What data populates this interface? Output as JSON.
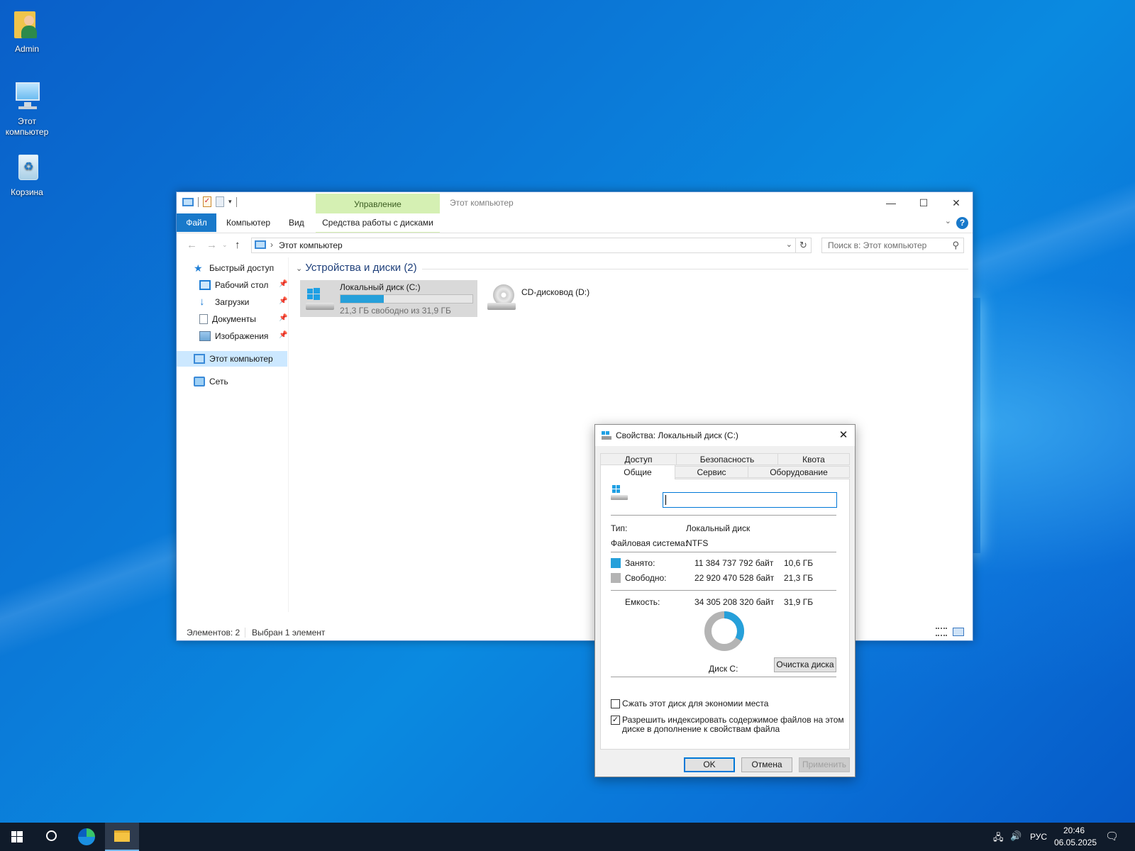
{
  "desktop": {
    "icons": [
      {
        "label": "Admin",
        "icon": "user-folder-icon"
      },
      {
        "label": "Этот компьютер",
        "icon": "computer-icon"
      },
      {
        "label": "Корзина",
        "icon": "recycle-bin-icon"
      }
    ]
  },
  "explorer": {
    "title": "Этот компьютер",
    "context_tab": "Управление",
    "ribbon_tabs": {
      "file": "Файл",
      "computer": "Компьютер",
      "view": "Вид",
      "drive_tools": "Средства работы с дисками"
    },
    "address": "Этот компьютер",
    "search_placeholder": "Поиск в: Этот компьютер",
    "sidebar": {
      "quick_access": "Быстрый доступ",
      "items": [
        "Рабочий стол",
        "Загрузки",
        "Документы",
        "Изображения"
      ],
      "this_pc": "Этот компьютер",
      "network": "Сеть"
    },
    "group_header": "Устройства и диски (2)",
    "drives": [
      {
        "name": "Локальный диск (C:)",
        "sub": "21,3 ГБ свободно из 31,9 ГБ",
        "used_fraction": 0.33,
        "selected": true
      },
      {
        "name": "CD-дисковод (D:)"
      }
    ],
    "status": {
      "items": "Элементов: 2",
      "selected": "Выбран 1 элемент"
    }
  },
  "dialog": {
    "title": "Свойства: Локальный диск (C:)",
    "tabs_row1": [
      "Доступ",
      "Безопасность",
      "Квота"
    ],
    "tabs_row2": [
      "Общие",
      "Сервис",
      "Оборудование"
    ],
    "active_tab": "Общие",
    "name_value": "",
    "type_label": "Тип:",
    "type_value": "Локальный диск",
    "fs_label": "Файловая система:",
    "fs_value": "NTFS",
    "used_label": "Занято:",
    "used_bytes": "11 384 737 792 байт",
    "used_gb": "10,6 ГБ",
    "free_label": "Свободно:",
    "free_bytes": "22 920 470 528 байт",
    "free_gb": "21,3 ГБ",
    "capacity_label": "Емкость:",
    "capacity_bytes": "34 305 208 320 байт",
    "capacity_gb": "31,9 ГБ",
    "used_fraction": 0.332,
    "disk_label": "Диск C:",
    "cleanup_button": "Очистка диска",
    "compress_label": "Сжать этот диск для экономии места",
    "compress_checked": false,
    "index_label_1": "Разрешить индексировать содержимое файлов на этом",
    "index_label_2": "диске в дополнение к свойствам файла",
    "index_checked": true,
    "ok": "OK",
    "cancel": "Отмена",
    "apply": "Применить",
    "colors": {
      "used": "#26a0da",
      "free": "#b4b4b4"
    }
  },
  "taskbar": {
    "language": "РУС",
    "time": "20:46",
    "date": "06.05.2025"
  }
}
